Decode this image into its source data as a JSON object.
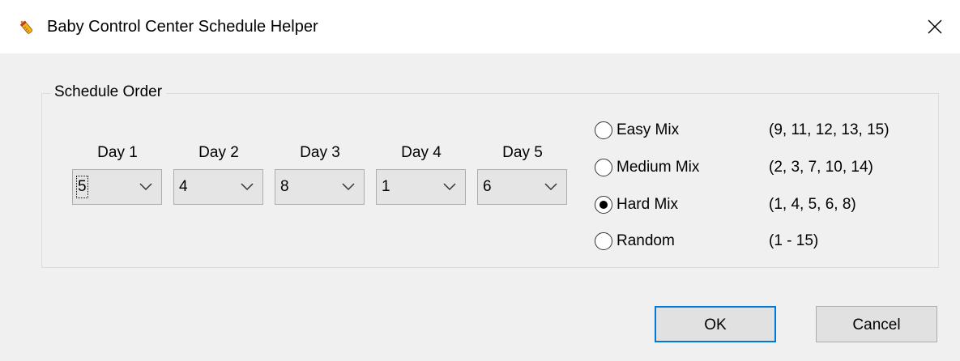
{
  "window": {
    "title": "Baby Control Center Schedule Helper",
    "icon": "baby-bottle-icon"
  },
  "schedule": {
    "group_label": "Schedule Order",
    "days": [
      {
        "label": "Day 1",
        "value": "5"
      },
      {
        "label": "Day 2",
        "value": "4"
      },
      {
        "label": "Day 3",
        "value": "8"
      },
      {
        "label": "Day 4",
        "value": "1"
      },
      {
        "label": "Day 5",
        "value": "6"
      }
    ],
    "mixes": [
      {
        "label": "Easy Mix",
        "desc": "(9, 11, 12, 13, 15)",
        "checked": false
      },
      {
        "label": "Medium Mix",
        "desc": "(2, 3, 7, 10, 14)",
        "checked": false
      },
      {
        "label": "Hard Mix",
        "desc": "(1, 4, 5, 6, 8)",
        "checked": true
      },
      {
        "label": "Random",
        "desc": "(1 - 15)",
        "checked": false
      }
    ]
  },
  "buttons": {
    "ok": "OK",
    "cancel": "Cancel"
  },
  "colors": {
    "focus_border": "#0078d7",
    "dialog_bg": "#f0f0f0"
  }
}
